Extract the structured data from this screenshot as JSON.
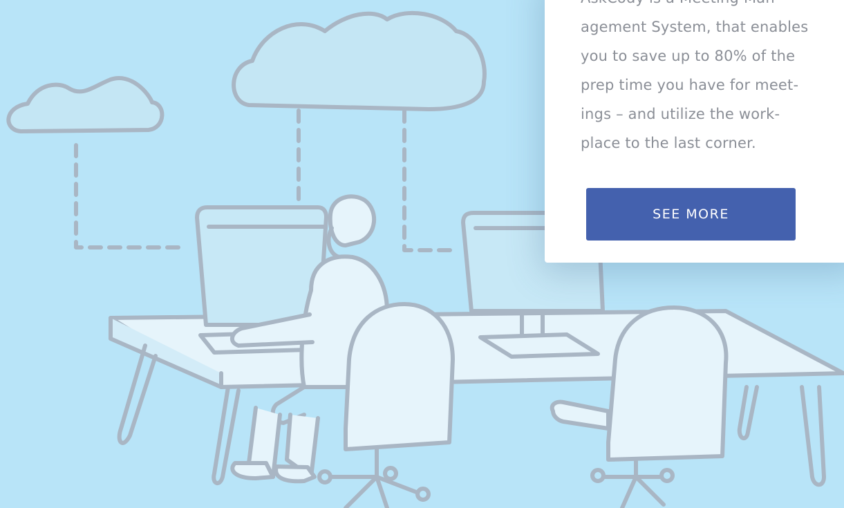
{
  "promo": {
    "lines": [
      "AskCody is a Meeting Man-",
      "agement System, that enables",
      "you to save up to 80% of the",
      "prep time you have for meet-",
      "ings – and utilize the work-",
      "place to the last corner."
    ],
    "button_label": "SEE MORE"
  },
  "colors": {
    "background": "#b8e4f8",
    "outline": "#a9b6c4",
    "fill_light": "#e6f4fb",
    "screen": "#c7e8f6",
    "accent_button": "#4461ae",
    "card_text": "#8a8e96"
  },
  "illustration": {
    "icons": [
      "cloud-icon",
      "monitor-icon",
      "desk-icon",
      "office-chair-icon",
      "person-icon"
    ]
  }
}
